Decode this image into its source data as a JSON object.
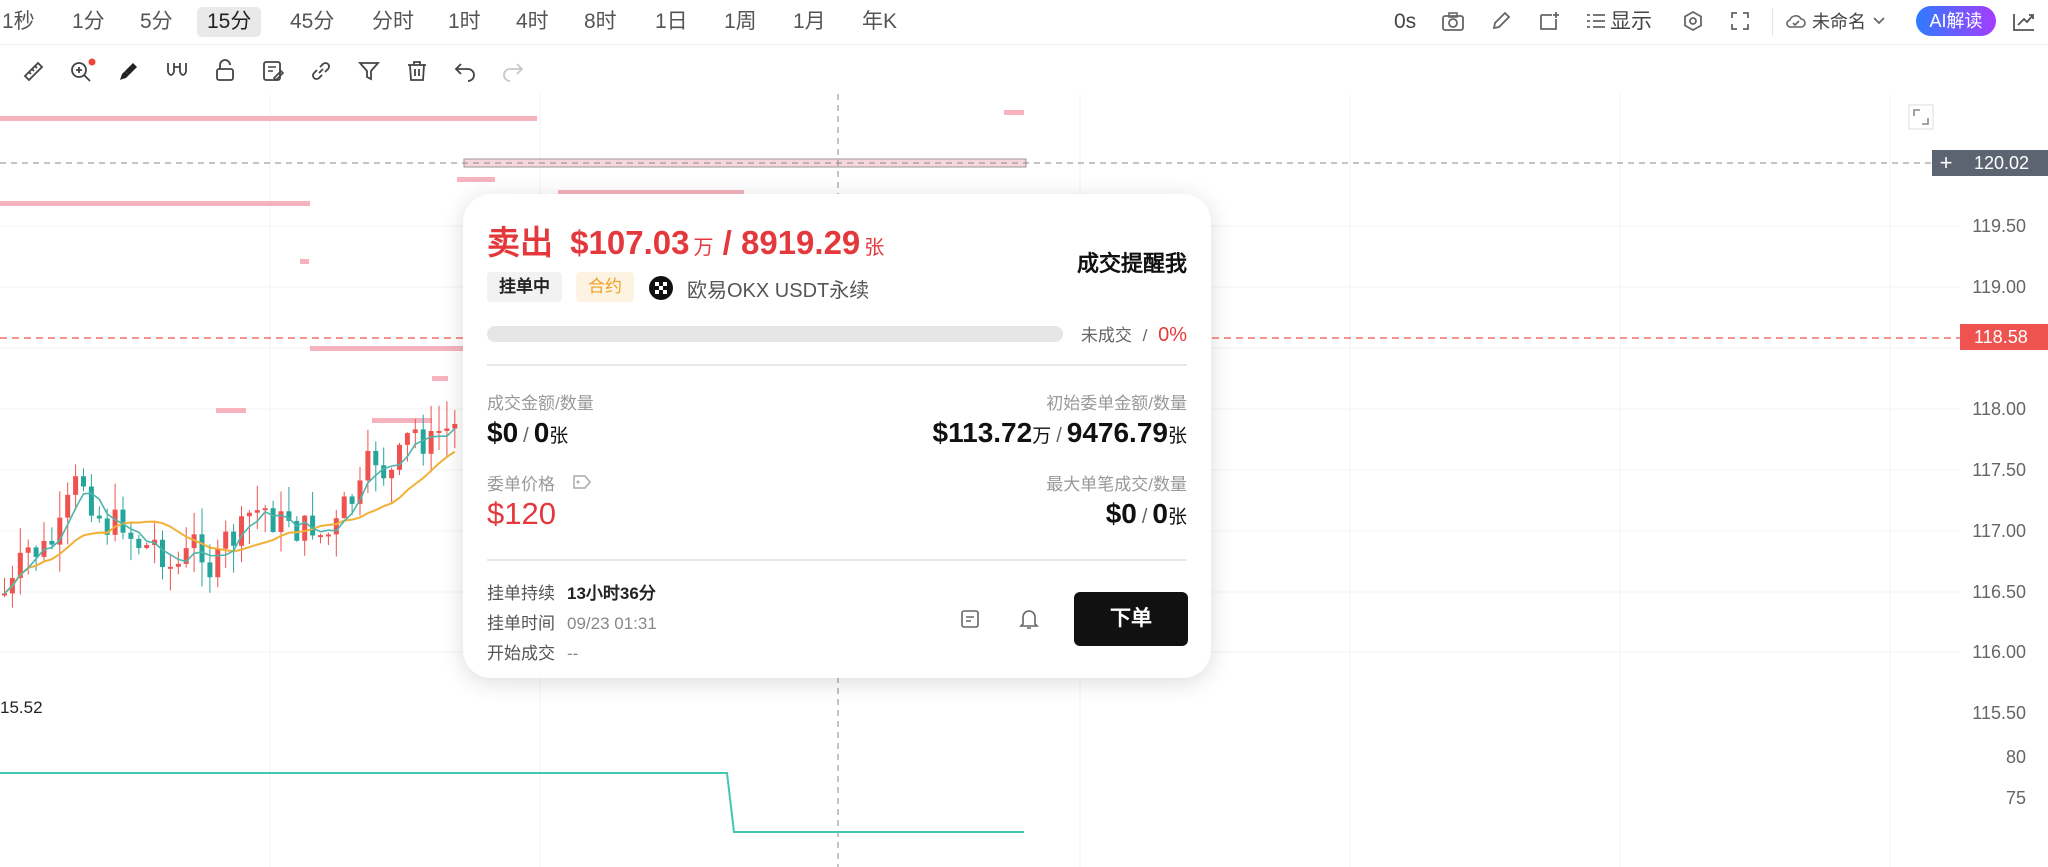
{
  "timeframes": [
    "1秒",
    "1分",
    "5分",
    "15分",
    "45分",
    "分时",
    "1时",
    "4时",
    "8时",
    "1日",
    "1周",
    "1月",
    "年K"
  ],
  "active_timeframe": "15分",
  "toolbar_right": {
    "countdown": "0s",
    "display_label": "显示",
    "layout_name": "未命名",
    "ai_label": "AI解读"
  },
  "price_axis": {
    "labels": [
      "119.50",
      "119.00",
      "118.00",
      "117.50",
      "117.00",
      "116.50",
      "116.00",
      "115.50"
    ],
    "indicator_labels": [
      "80",
      "75"
    ],
    "crosshair_price": "120.02",
    "current_price": "118.58",
    "low_label": "15.52"
  },
  "popup": {
    "side": "卖出",
    "amount": "$107.03",
    "amount_unit": "万",
    "separator": " / ",
    "qty": "8919.29",
    "qty_unit": "张",
    "status_badge": "挂单中",
    "type_badge": "合约",
    "exchange": "欧易OKX USDT永续",
    "remind_label": "成交提醒我",
    "progress_label": "未成交",
    "progress_sep": "/",
    "progress_value": "0%",
    "progress_fraction": 0,
    "filled_label": "成交金额/数量",
    "filled_amount": "$0",
    "filled_sep": "/",
    "filled_qty": "0",
    "filled_qty_unit": "张",
    "initial_label": "初始委单金额/数量",
    "initial_amount": "$113.72",
    "initial_amount_unit": "万",
    "initial_sep": "/",
    "initial_qty": "9476.79",
    "initial_qty_unit": "张",
    "price_label": "委单价格",
    "price_value": "$120",
    "max_label": "最大单笔成交/数量",
    "max_amount": "$0",
    "max_sep": "/",
    "max_qty": "0",
    "max_qty_unit": "张",
    "duration_label": "挂单持续",
    "duration_value": "13小时36分",
    "time_label": "挂单时间",
    "time_value": "09/23 01:31",
    "start_label": "开始成交",
    "start_value": "--",
    "order_button": "下单"
  },
  "colors": {
    "up": "#26a69a",
    "down": "#ef5350",
    "sell": "#e4393c",
    "ma_yellow": "#f2b035",
    "ma_teal": "#4db6ac",
    "indicator": "#3fc9b5",
    "orderbook_pink": "#f6b3bd"
  }
}
